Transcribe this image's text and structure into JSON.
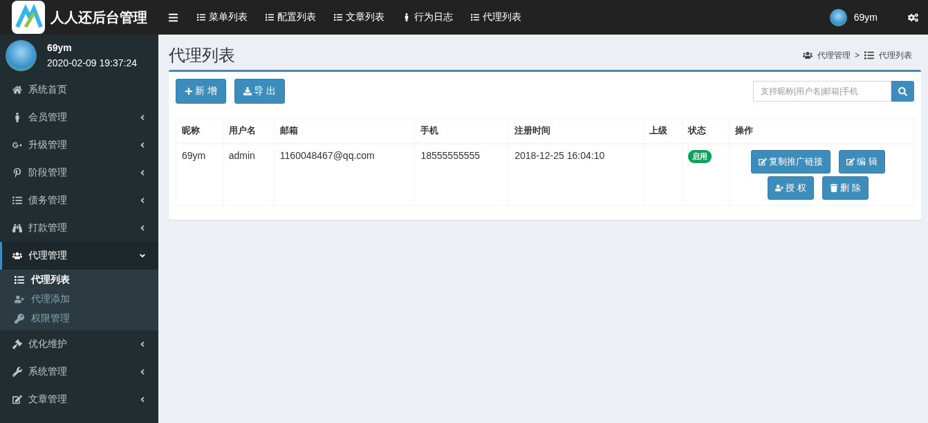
{
  "brand": {
    "title": "人人还后台管理"
  },
  "topnav": [
    {
      "label": "菜单列表"
    },
    {
      "label": "配置列表"
    },
    {
      "label": "文章列表"
    },
    {
      "label": "行为日志"
    },
    {
      "label": "代理列表"
    }
  ],
  "top_user": {
    "name": "69ym"
  },
  "user_panel": {
    "name": "69ym",
    "time": "2020-02-09 19:37:24"
  },
  "sidebar": {
    "items": [
      {
        "label": "系统首页",
        "selected": false
      },
      {
        "label": "会员管理",
        "expanded": false,
        "selected": false
      },
      {
        "label": "升级管理",
        "expanded": false,
        "selected": false
      },
      {
        "label": "阶段管理",
        "expanded": false,
        "selected": false
      },
      {
        "label": "债务管理",
        "expanded": false,
        "selected": false
      },
      {
        "label": "打款管理",
        "expanded": false,
        "selected": false
      },
      {
        "label": "代理管理",
        "expanded": true,
        "selected": true,
        "children": [
          {
            "label": "代理列表",
            "selected": true
          },
          {
            "label": "代理添加",
            "selected": false
          },
          {
            "label": "权限管理",
            "selected": false
          }
        ]
      },
      {
        "label": "优化维护",
        "expanded": false,
        "selected": false
      },
      {
        "label": "系统管理",
        "expanded": false,
        "selected": false
      },
      {
        "label": "文章管理",
        "expanded": false,
        "selected": false
      }
    ]
  },
  "page": {
    "title": "代理列表",
    "breadcrumb": [
      "代理管理",
      "代理列表"
    ],
    "breadcrumb_separator": ">"
  },
  "toolbar": {
    "buttons": [
      "新 增",
      "导 出"
    ],
    "search": {
      "placeholder": "支持昵称|用户名|邮箱|手机"
    }
  },
  "table": {
    "columns": [
      "昵称",
      "用户名",
      "邮箱",
      "手机",
      "注册时间",
      "上级",
      "状态",
      "操作"
    ],
    "rows": [
      {
        "cells": [
          "69ym",
          "admin",
          "1160048467@qq.com",
          "18555555555",
          "2018-12-25 16:04:10",
          ""
        ],
        "status": {
          "label": "启用",
          "enabled": true
        },
        "actions": [
          "复制推广链接",
          "编 辑",
          "授 权",
          "删 除"
        ]
      }
    ]
  }
}
